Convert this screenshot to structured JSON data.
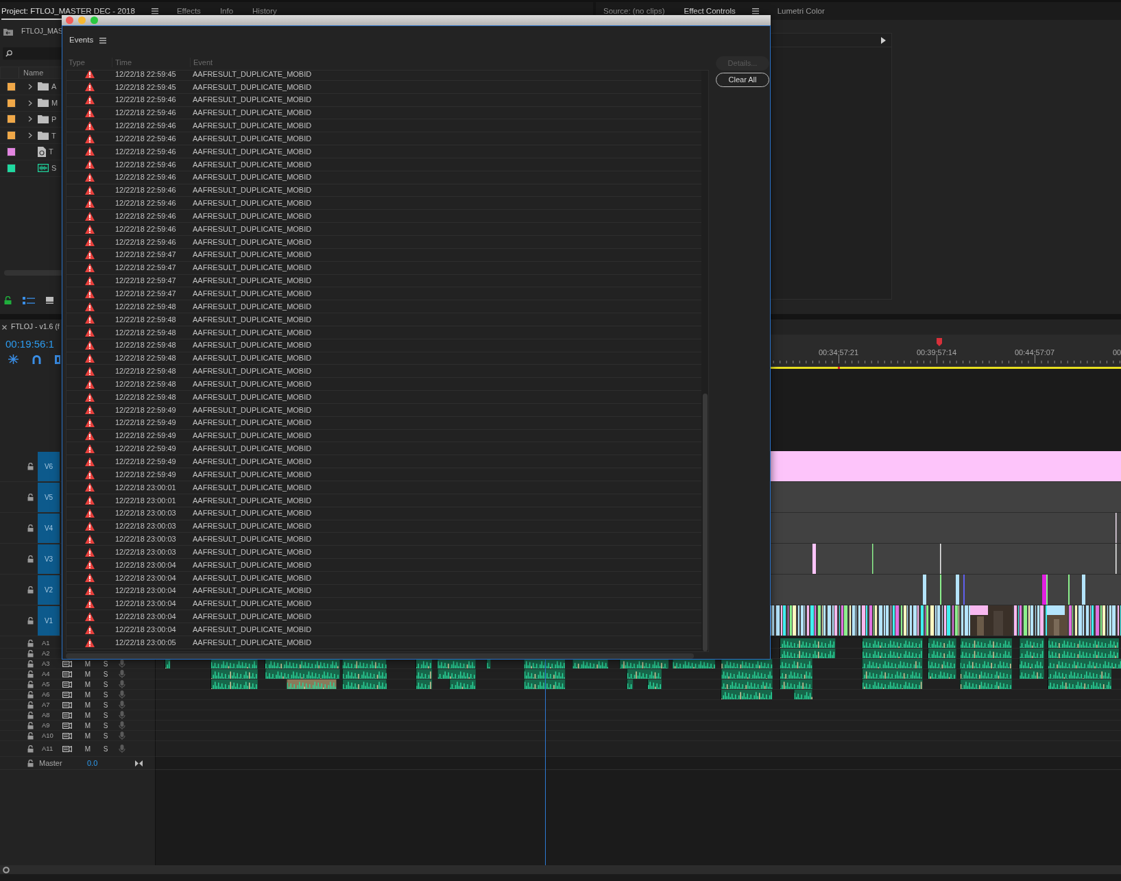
{
  "project_panel": {
    "tabs": [
      {
        "label": "Project: FTLOJ_MASTER DEC - 2018",
        "selected": true
      },
      {
        "label": "Effects",
        "selected": false
      },
      {
        "label": "Info",
        "selected": false
      },
      {
        "label": "History",
        "selected": false
      }
    ],
    "breadcrumb": "FTLOJ_MAS",
    "columns": [
      "Name"
    ],
    "items": [
      {
        "kind": "folder",
        "color": "#f0a848",
        "name": "A"
      },
      {
        "kind": "folder",
        "color": "#f0a848",
        "name": "M"
      },
      {
        "kind": "folder",
        "color": "#f0a848",
        "name": "P"
      },
      {
        "kind": "folder",
        "color": "#f0a848",
        "name": "T"
      },
      {
        "kind": "file",
        "color": "#e285e0",
        "name": "T"
      },
      {
        "kind": "sequence",
        "color": "#1fd9a0",
        "name": "S"
      }
    ]
  },
  "source_panel": {
    "tabs": [
      {
        "label": "Source: (no clips)",
        "selected": false
      },
      {
        "label": "Effect Controls",
        "selected": true
      },
      {
        "label": "Lumetri Color",
        "selected": false
      }
    ]
  },
  "timeline": {
    "title": "FTLOJ - v1.6 (f",
    "timecode": "00:19:56:1",
    "ruler_labels": [
      "00:34:57:21",
      "00:39:57:14",
      "00:44:57:07",
      "00"
    ],
    "video_tracks": [
      {
        "label": "V6"
      },
      {
        "label": "V5"
      },
      {
        "label": "V4"
      },
      {
        "label": "V3"
      },
      {
        "label": "V2"
      },
      {
        "label": "V1"
      }
    ],
    "audio_tracks": [
      {
        "label": "A1"
      },
      {
        "label": "A2"
      },
      {
        "label": "A3",
        "mute": "M",
        "solo": "S"
      },
      {
        "label": "A4",
        "mute": "M",
        "solo": "S"
      },
      {
        "label": "A5",
        "mute": "M",
        "solo": "S"
      },
      {
        "label": "A6",
        "mute": "M",
        "solo": "S"
      },
      {
        "label": "A7",
        "mute": "M",
        "solo": "S"
      },
      {
        "label": "A8",
        "mute": "M",
        "solo": "S"
      },
      {
        "label": "A9",
        "mute": "M",
        "solo": "S"
      },
      {
        "label": "A10",
        "mute": "M",
        "solo": "S"
      },
      {
        "label": "A11",
        "mute": "M",
        "solo": "S"
      }
    ],
    "master": {
      "label": "Master",
      "value": "0.0"
    }
  },
  "events_dialog": {
    "title": "Events",
    "columns": [
      "Type",
      "Time",
      "Event"
    ],
    "rows": [
      {
        "kind": "error",
        "time": "12/22/18 22:59:45",
        "event": "AAFRESULT_DUPLICATE_MOBID"
      },
      {
        "kind": "error",
        "time": "12/22/18 22:59:45",
        "event": "AAFRESULT_DUPLICATE_MOBID"
      },
      {
        "kind": "error",
        "time": "12/22/18 22:59:46",
        "event": "AAFRESULT_DUPLICATE_MOBID"
      },
      {
        "kind": "error",
        "time": "12/22/18 22:59:46",
        "event": "AAFRESULT_DUPLICATE_MOBID"
      },
      {
        "kind": "error",
        "time": "12/22/18 22:59:46",
        "event": "AAFRESULT_DUPLICATE_MOBID"
      },
      {
        "kind": "error",
        "time": "12/22/18 22:59:46",
        "event": "AAFRESULT_DUPLICATE_MOBID"
      },
      {
        "kind": "error",
        "time": "12/22/18 22:59:46",
        "event": "AAFRESULT_DUPLICATE_MOBID"
      },
      {
        "kind": "error",
        "time": "12/22/18 22:59:46",
        "event": "AAFRESULT_DUPLICATE_MOBID"
      },
      {
        "kind": "error",
        "time": "12/22/18 22:59:46",
        "event": "AAFRESULT_DUPLICATE_MOBID"
      },
      {
        "kind": "error",
        "time": "12/22/18 22:59:46",
        "event": "AAFRESULT_DUPLICATE_MOBID"
      },
      {
        "kind": "error",
        "time": "12/22/18 22:59:46",
        "event": "AAFRESULT_DUPLICATE_MOBID"
      },
      {
        "kind": "error",
        "time": "12/22/18 22:59:46",
        "event": "AAFRESULT_DUPLICATE_MOBID"
      },
      {
        "kind": "error",
        "time": "12/22/18 22:59:46",
        "event": "AAFRESULT_DUPLICATE_MOBID"
      },
      {
        "kind": "error",
        "time": "12/22/18 22:59:46",
        "event": "AAFRESULT_DUPLICATE_MOBID"
      },
      {
        "kind": "error",
        "time": "12/22/18 22:59:47",
        "event": "AAFRESULT_DUPLICATE_MOBID"
      },
      {
        "kind": "error",
        "time": "12/22/18 22:59:47",
        "event": "AAFRESULT_DUPLICATE_MOBID"
      },
      {
        "kind": "error",
        "time": "12/22/18 22:59:47",
        "event": "AAFRESULT_DUPLICATE_MOBID"
      },
      {
        "kind": "error",
        "time": "12/22/18 22:59:47",
        "event": "AAFRESULT_DUPLICATE_MOBID"
      },
      {
        "kind": "error",
        "time": "12/22/18 22:59:48",
        "event": "AAFRESULT_DUPLICATE_MOBID"
      },
      {
        "kind": "error",
        "time": "12/22/18 22:59:48",
        "event": "AAFRESULT_DUPLICATE_MOBID"
      },
      {
        "kind": "error",
        "time": "12/22/18 22:59:48",
        "event": "AAFRESULT_DUPLICATE_MOBID"
      },
      {
        "kind": "error",
        "time": "12/22/18 22:59:48",
        "event": "AAFRESULT_DUPLICATE_MOBID"
      },
      {
        "kind": "error",
        "time": "12/22/18 22:59:48",
        "event": "AAFRESULT_DUPLICATE_MOBID"
      },
      {
        "kind": "error",
        "time": "12/22/18 22:59:48",
        "event": "AAFRESULT_DUPLICATE_MOBID"
      },
      {
        "kind": "error",
        "time": "12/22/18 22:59:48",
        "event": "AAFRESULT_DUPLICATE_MOBID"
      },
      {
        "kind": "error",
        "time": "12/22/18 22:59:48",
        "event": "AAFRESULT_DUPLICATE_MOBID"
      },
      {
        "kind": "error",
        "time": "12/22/18 22:59:49",
        "event": "AAFRESULT_DUPLICATE_MOBID"
      },
      {
        "kind": "error",
        "time": "12/22/18 22:59:49",
        "event": "AAFRESULT_DUPLICATE_MOBID"
      },
      {
        "kind": "error",
        "time": "12/22/18 22:59:49",
        "event": "AAFRESULT_DUPLICATE_MOBID"
      },
      {
        "kind": "error",
        "time": "12/22/18 22:59:49",
        "event": "AAFRESULT_DUPLICATE_MOBID"
      },
      {
        "kind": "error",
        "time": "12/22/18 22:59:49",
        "event": "AAFRESULT_DUPLICATE_MOBID"
      },
      {
        "kind": "error",
        "time": "12/22/18 22:59:49",
        "event": "AAFRESULT_DUPLICATE_MOBID"
      },
      {
        "kind": "error",
        "time": "12/22/18 23:00:01",
        "event": "AAFRESULT_DUPLICATE_MOBID"
      },
      {
        "kind": "error",
        "time": "12/22/18 23:00:01",
        "event": "AAFRESULT_DUPLICATE_MOBID"
      },
      {
        "kind": "error",
        "time": "12/22/18 23:00:03",
        "event": "AAFRESULT_DUPLICATE_MOBID"
      },
      {
        "kind": "error",
        "time": "12/22/18 23:00:03",
        "event": "AAFRESULT_DUPLICATE_MOBID"
      },
      {
        "kind": "error",
        "time": "12/22/18 23:00:03",
        "event": "AAFRESULT_DUPLICATE_MOBID"
      },
      {
        "kind": "error",
        "time": "12/22/18 23:00:03",
        "event": "AAFRESULT_DUPLICATE_MOBID"
      },
      {
        "kind": "error",
        "time": "12/22/18 23:00:04",
        "event": "AAFRESULT_DUPLICATE_MOBID"
      },
      {
        "kind": "error",
        "time": "12/22/18 23:00:04",
        "event": "AAFRESULT_DUPLICATE_MOBID"
      },
      {
        "kind": "error",
        "time": "12/22/18 23:00:04",
        "event": "AAFRESULT_DUPLICATE_MOBID"
      },
      {
        "kind": "error",
        "time": "12/22/18 23:00:04",
        "event": "AAFRESULT_DUPLICATE_MOBID"
      },
      {
        "kind": "error",
        "time": "12/22/18 23:00:04",
        "event": "AAFRESULT_DUPLICATE_MOBID"
      },
      {
        "kind": "error",
        "time": "12/22/18 23:00:04",
        "event": "AAFRESULT_DUPLICATE_MOBID"
      },
      {
        "kind": "error",
        "time": "12/22/18 23:00:05",
        "event": "AAFRESULT_DUPLICATE_MOBID"
      }
    ],
    "buttons": [
      {
        "label": "Details...",
        "disabled": true
      },
      {
        "label": "Clear All",
        "disabled": false
      }
    ]
  }
}
